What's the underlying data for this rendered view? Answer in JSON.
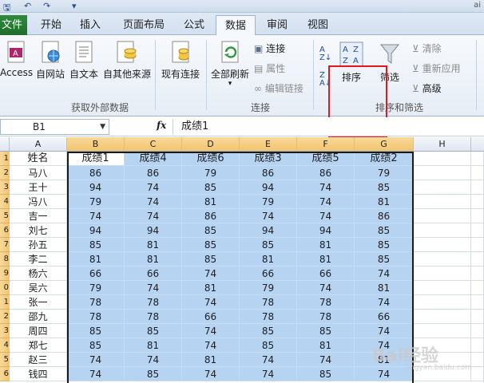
{
  "title_fragment": "ai",
  "tabs": {
    "file": "文件",
    "items": [
      "开始",
      "插入",
      "页面布局",
      "公式",
      "数据",
      "审阅",
      "视图"
    ],
    "active": "数据"
  },
  "ribbon": {
    "get_external": {
      "access": "Access",
      "web": "自网站",
      "text": "自文本",
      "other": "自其他来源",
      "existing": "现有连接",
      "group": "获取外部数据"
    },
    "connections": {
      "refresh_all": "全部刷新",
      "connections": "连接",
      "properties": "属性",
      "edit_links": "编辑链接",
      "group": "连接"
    },
    "sort_filter": {
      "sort": "排序",
      "filter": "筛选",
      "clear": "清除",
      "reapply": "重新应用",
      "advanced": "高级",
      "group": "排序和筛选"
    }
  },
  "formula_bar": {
    "name_box": "B1",
    "fx": "fx",
    "content": "成绩1"
  },
  "sheet": {
    "columns": [
      "A",
      "B",
      "C",
      "D",
      "E",
      "F",
      "G",
      "H"
    ],
    "row_numbers": [
      "1",
      "2",
      "3",
      "4",
      "5",
      "6",
      "7",
      "8",
      "9",
      "0",
      "1",
      "2",
      "3",
      "4",
      "5",
      "6"
    ],
    "header_row": [
      "姓名",
      "成绩1",
      "成绩4",
      "成绩6",
      "成绩3",
      "成绩5",
      "成绩2"
    ],
    "rows": [
      [
        "马八",
        "86",
        "86",
        "79",
        "86",
        "86",
        "79"
      ],
      [
        "王十",
        "94",
        "74",
        "85",
        "94",
        "74",
        "85"
      ],
      [
        "冯八",
        "79",
        "74",
        "81",
        "79",
        "74",
        "81"
      ],
      [
        "吉一",
        "74",
        "74",
        "86",
        "74",
        "74",
        "86"
      ],
      [
        "刘七",
        "94",
        "94",
        "85",
        "94",
        "94",
        "85"
      ],
      [
        "孙五",
        "85",
        "81",
        "85",
        "85",
        "81",
        "85"
      ],
      [
        "李二",
        "81",
        "81",
        "85",
        "81",
        "81",
        "85"
      ],
      [
        "杨六",
        "66",
        "66",
        "74",
        "66",
        "66",
        "74"
      ],
      [
        "吴六",
        "79",
        "74",
        "81",
        "79",
        "74",
        "81"
      ],
      [
        "张一",
        "78",
        "78",
        "74",
        "78",
        "78",
        "74"
      ],
      [
        "邵九",
        "78",
        "78",
        "66",
        "78",
        "78",
        "66"
      ],
      [
        "周四",
        "85",
        "85",
        "74",
        "85",
        "85",
        "74"
      ],
      [
        "郑七",
        "85",
        "81",
        "74",
        "85",
        "81",
        "74"
      ],
      [
        "赵三",
        "74",
        "74",
        "81",
        "74",
        "74",
        "81"
      ],
      [
        "钱四",
        "74",
        "85",
        "74",
        "74",
        "85",
        "74"
      ]
    ]
  },
  "colors": {
    "selection": "#b6d3f2",
    "header_selected": "#f2c46d",
    "file_tab": "#2f8a3c",
    "highlight_box": "#e3171c"
  },
  "watermark": "Bai经验"
}
